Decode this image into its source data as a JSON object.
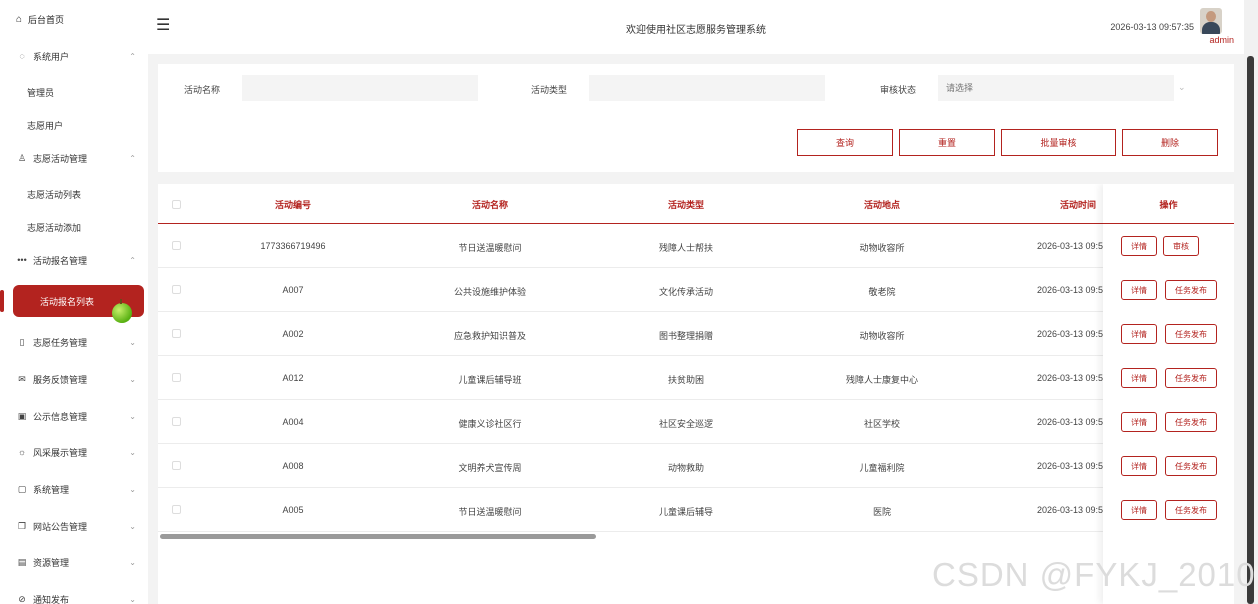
{
  "sidebar": {
    "home": "后台首页",
    "groups": [
      {
        "label": "系统用户",
        "icon": "circle-icon",
        "chevron": "^"
      },
      {
        "label": "志愿活动管理",
        "icon": "user-icon",
        "chevron": "^"
      },
      {
        "label": "活动报名管理",
        "icon": "dots-icon",
        "chevron": "^"
      },
      {
        "label": "志愿任务管理",
        "icon": "mic-icon",
        "chevron": "v"
      },
      {
        "label": "服务反馈管理",
        "icon": "mail-icon",
        "chevron": "v"
      },
      {
        "label": "公示信息管理",
        "icon": "save-icon",
        "chevron": "v"
      },
      {
        "label": "风采展示管理",
        "icon": "sun-icon",
        "chevron": "v"
      },
      {
        "label": "系统管理",
        "icon": "tablet-icon",
        "chevron": "v"
      },
      {
        "label": "网站公告管理",
        "icon": "copy-icon",
        "chevron": "v"
      },
      {
        "label": "资源管理",
        "icon": "document-icon",
        "chevron": "v"
      },
      {
        "label": "通知发布",
        "icon": "attach-icon",
        "chevron": "v"
      }
    ],
    "sub": {
      "admin": "管理员",
      "volunteer_user": "志愿用户",
      "activity_list": "志愿活动列表",
      "activity_add": "志愿活动添加",
      "signup_list": "活动报名列表"
    }
  },
  "header": {
    "title": "欢迎使用社区志愿服务管理系统",
    "time": "2026-03-13 09:57:35",
    "user": "admin"
  },
  "search": {
    "name_label": "活动名称",
    "type_label": "活动类型",
    "status_label": "审核状态",
    "status_placeholder": "请选择",
    "buttons": {
      "query": "查询",
      "reset": "重置",
      "batch": "批量审核",
      "delete": "删除"
    }
  },
  "table": {
    "headers": {
      "id": "活动编号",
      "name": "活动名称",
      "type": "活动类型",
      "place": "活动地点",
      "time": "活动时间",
      "ops": "操作"
    },
    "rows": [
      {
        "id": "1773366719496",
        "name": "节日送温暖慰问",
        "type": "残障人士帮扶",
        "place": "动物收容所",
        "time": "2026-03-13 09:5",
        "op1": "详情",
        "op2": "审核"
      },
      {
        "id": "A007",
        "name": "公共设施维护体验",
        "type": "文化传承活动",
        "place": "敬老院",
        "time": "2026-03-13 09:5",
        "op1": "详情",
        "op2": "任务发布"
      },
      {
        "id": "A002",
        "name": "应急救护知识普及",
        "type": "图书整理捐赠",
        "place": "动物收容所",
        "time": "2026-03-13 09:5",
        "op1": "详情",
        "op2": "任务发布"
      },
      {
        "id": "A012",
        "name": "儿童课后辅导班",
        "type": "扶贫助困",
        "place": "残障人士康复中心",
        "time": "2026-03-13 09:5",
        "op1": "详情",
        "op2": "任务发布"
      },
      {
        "id": "A004",
        "name": "健康义诊社区行",
        "type": "社区安全巡逻",
        "place": "社区学校",
        "time": "2026-03-13 09:5",
        "op1": "详情",
        "op2": "任务发布"
      },
      {
        "id": "A008",
        "name": "文明养犬宣传周",
        "type": "动物救助",
        "place": "儿童福利院",
        "time": "2026-03-13 09:5",
        "op1": "详情",
        "op2": "任务发布"
      },
      {
        "id": "A005",
        "name": "节日送温暖慰问",
        "type": "儿童课后辅导",
        "place": "医院",
        "time": "2026-03-13 09:5",
        "op1": "详情",
        "op2": "任务发布"
      }
    ]
  },
  "watermark": "CSDN @FYKJ_2010",
  "colors": {
    "accent": "#b3231f",
    "background": "#f3f3f3"
  }
}
